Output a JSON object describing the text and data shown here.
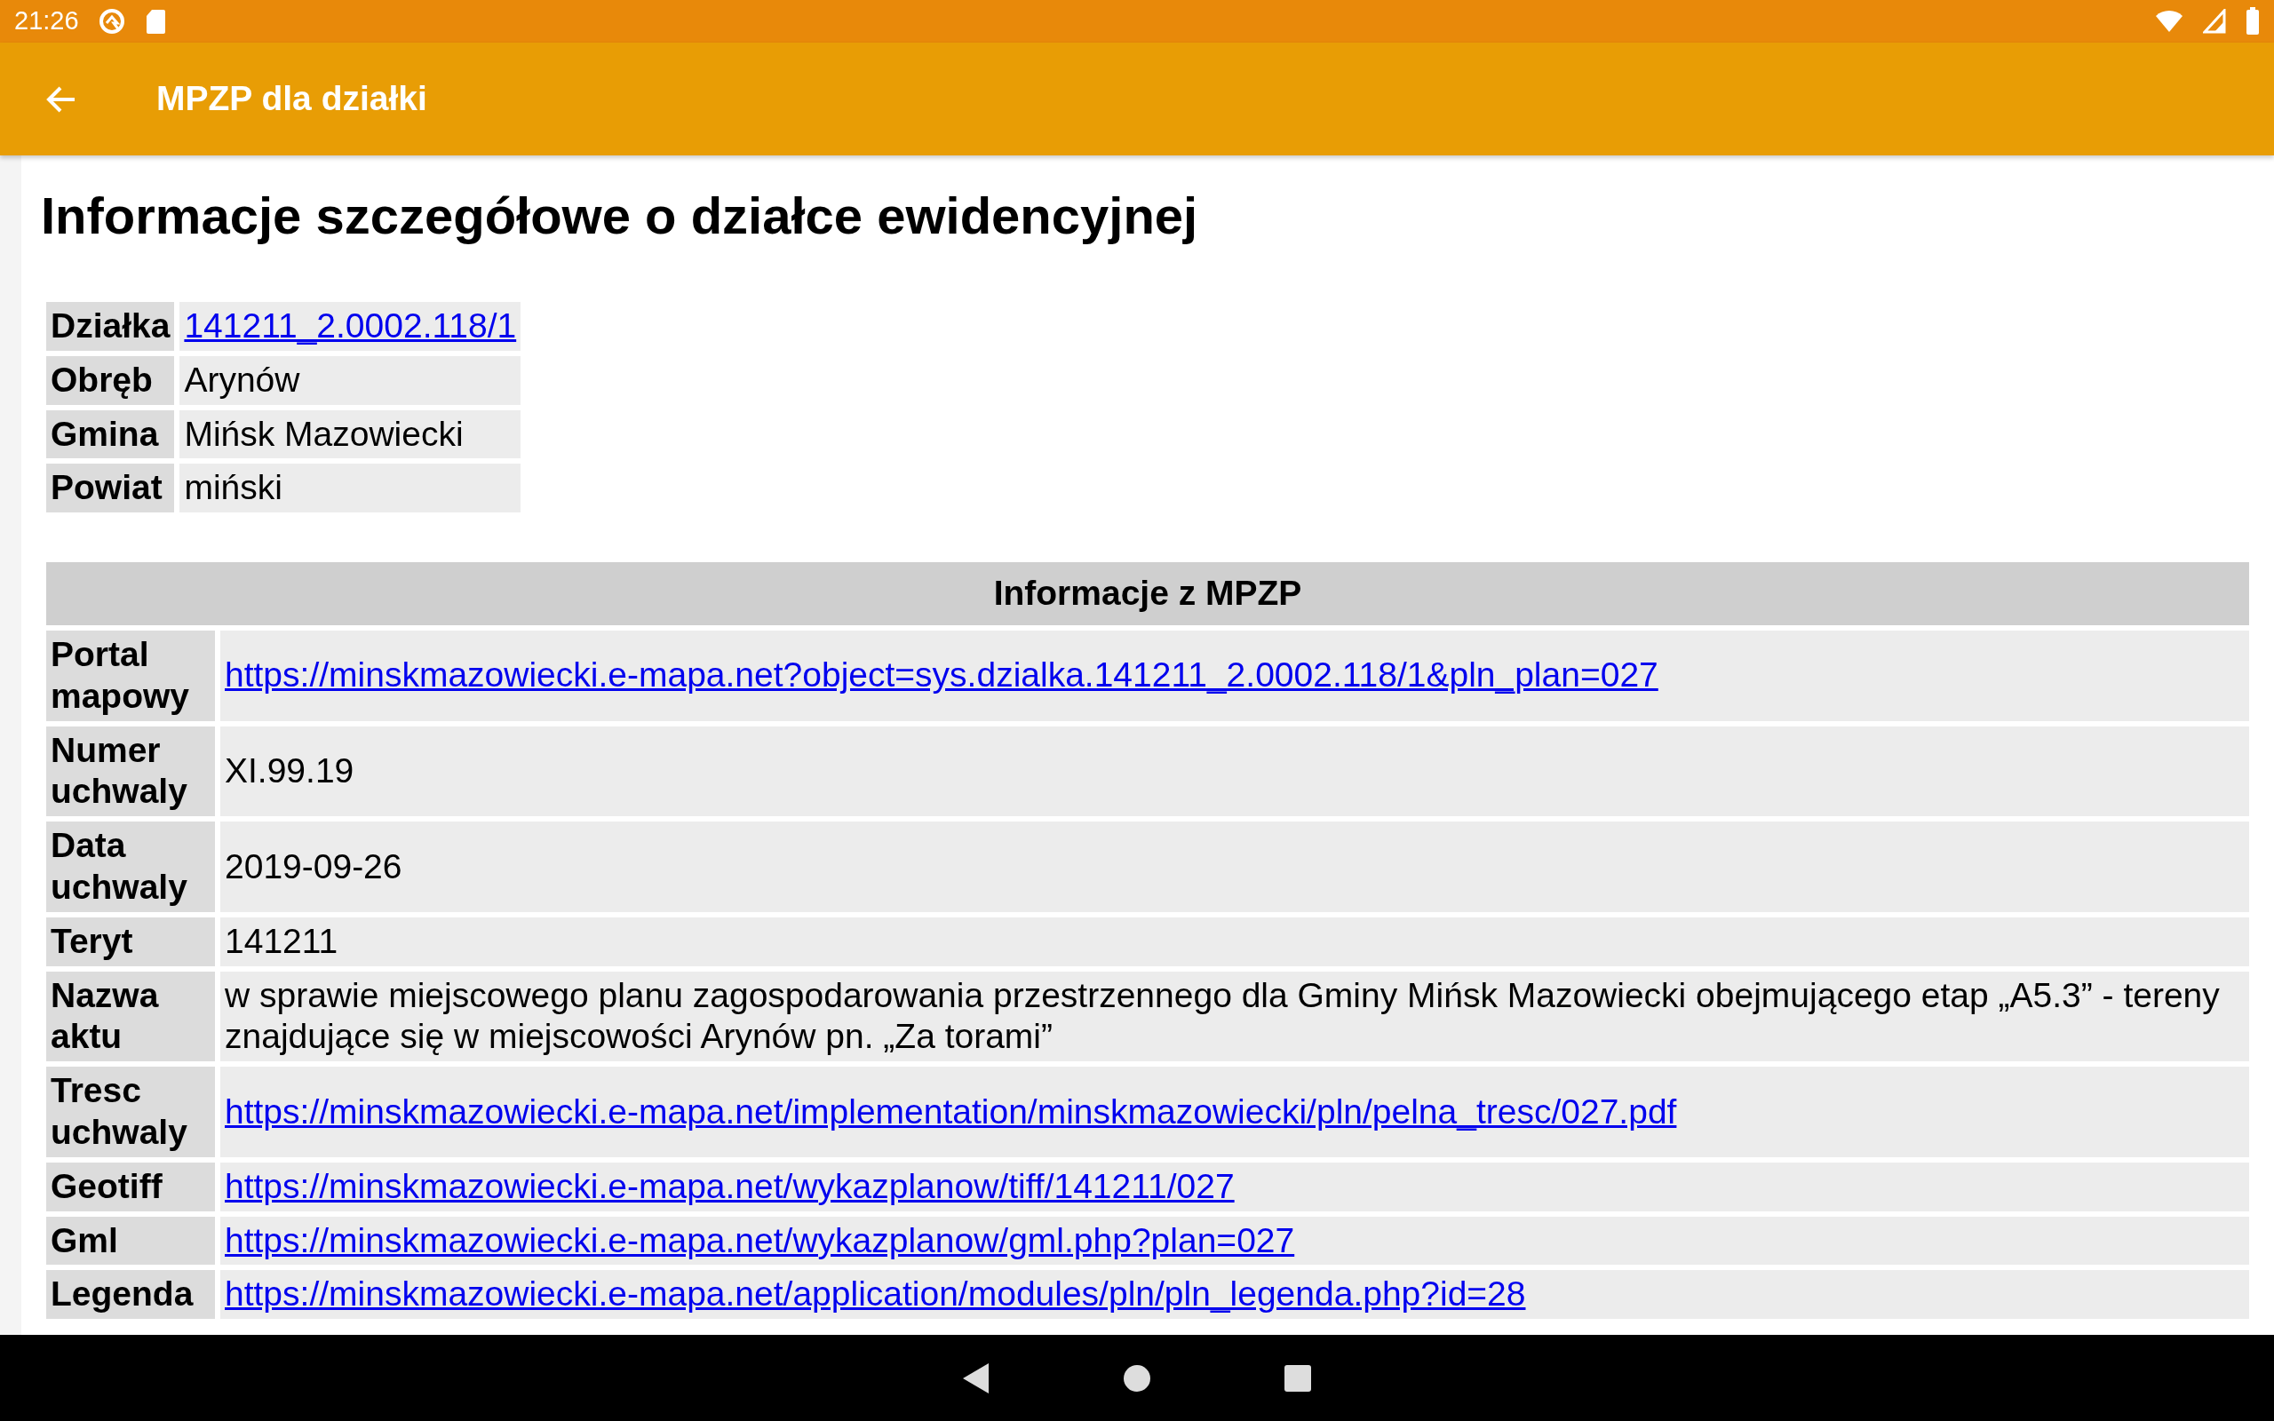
{
  "status_bar": {
    "time": "21:26"
  },
  "app_bar": {
    "title": "MPZP dla działki"
  },
  "heading": "Informacje szczegółowe o działce ewidencyjnej",
  "parcel_table": {
    "rows": [
      {
        "label": "Działka",
        "value": "141211_2.0002.118/1",
        "kind": "link"
      },
      {
        "label": "Obręb",
        "value": "Arynów",
        "kind": "text"
      },
      {
        "label": "Gmina",
        "value": "Mińsk Mazowiecki",
        "kind": "text"
      },
      {
        "label": "Powiat",
        "value": "miński",
        "kind": "text"
      }
    ]
  },
  "mpzp_table": {
    "title": "Informacje z MPZP",
    "rows": [
      {
        "label": "Portal mapowy",
        "value": "https://minskmazowiecki.e-mapa.net?object=sys.dzialka.141211_2.0002.118/1&pln_plan=027",
        "kind": "link"
      },
      {
        "label": "Numer uchwaly",
        "value": "XI.99.19",
        "kind": "text"
      },
      {
        "label": "Data uchwaly",
        "value": "2019-09-26",
        "kind": "text"
      },
      {
        "label": "Teryt",
        "value": "141211",
        "kind": "text"
      },
      {
        "label": "Nazwa aktu",
        "value": "w sprawie miejscowego planu zagospodarowania przestrzennego dla Gminy Mińsk Mazowiecki obejmującego etap „A5.3” - tereny znajdujące się w miejscowości Arynów pn. „Za torami”",
        "kind": "text"
      },
      {
        "label": "Tresc uchwaly",
        "value": "https://minskmazowiecki.e-mapa.net/implementation/minskmazowiecki/pln/pelna_tresc/027.pdf",
        "kind": "link"
      },
      {
        "label": "Geotiff",
        "value": "https://minskmazowiecki.e-mapa.net/wykazplanow/tiff/141211/027",
        "kind": "link"
      },
      {
        "label": "Gml",
        "value": "https://minskmazowiecki.e-mapa.net/wykazplanow/gml.php?plan=027",
        "kind": "link"
      },
      {
        "label": "Legenda",
        "value": "https://minskmazowiecki.e-mapa.net/application/modules/pln/pln_legenda.php?id=28",
        "kind": "link"
      }
    ]
  }
}
